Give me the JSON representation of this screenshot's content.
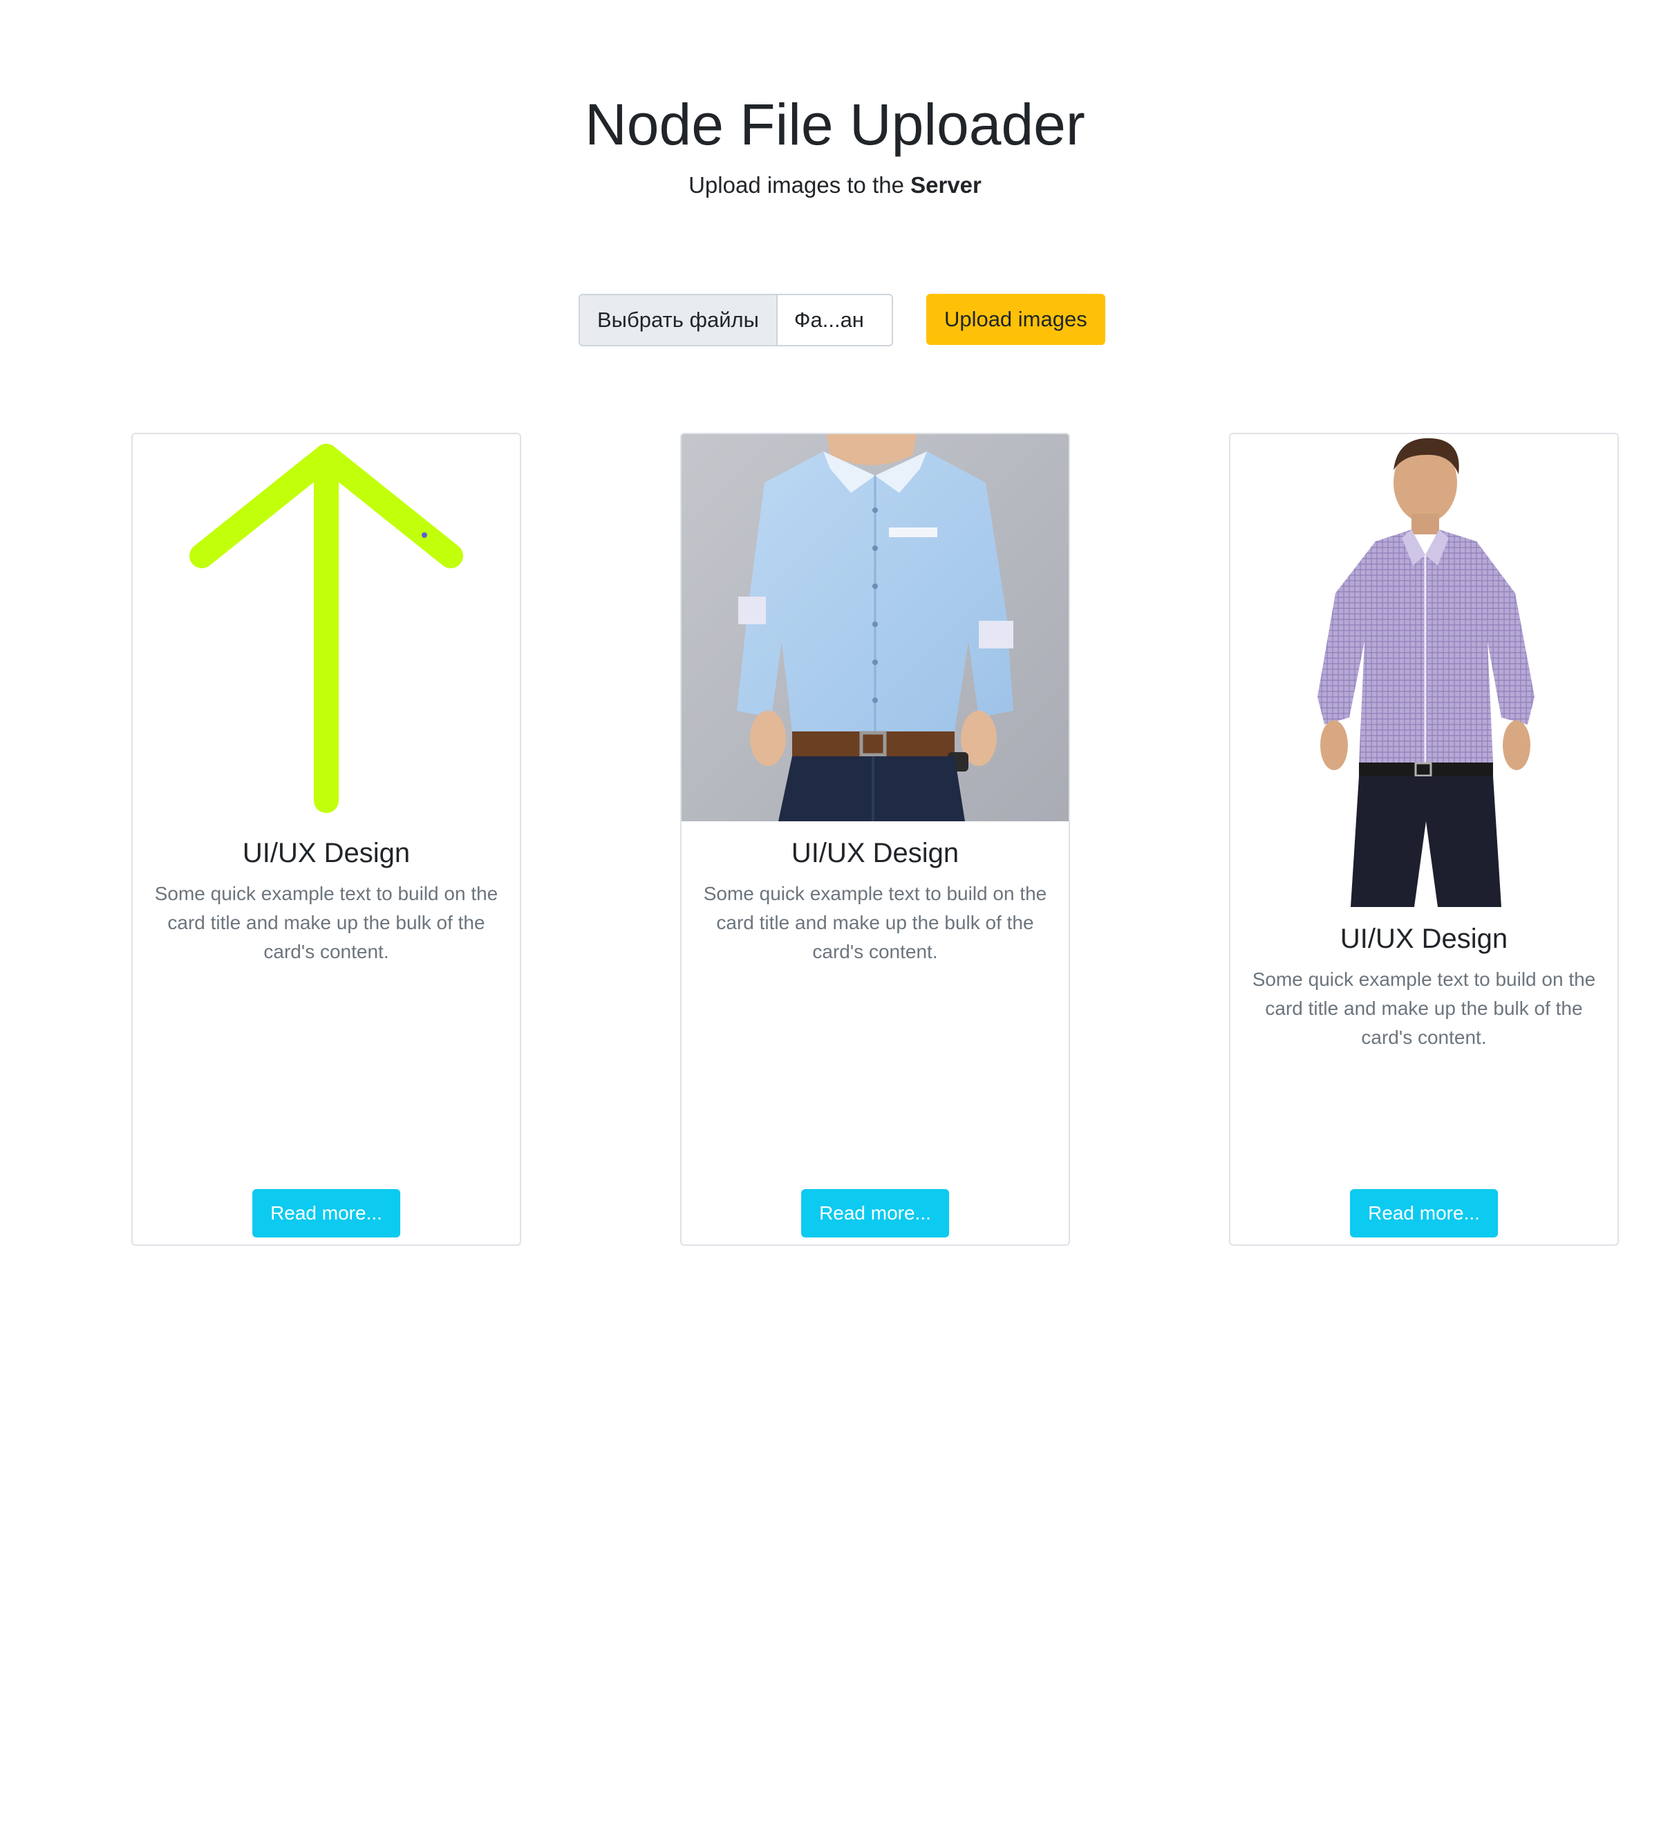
{
  "header": {
    "title": "Node File Uploader",
    "subtitle_prefix": "Upload images to the ",
    "subtitle_strong": "Server"
  },
  "upload": {
    "choose_label": "Выбрать файлы",
    "file_name": "Фа...ан",
    "upload_label": "Upload images"
  },
  "colors": {
    "upload_button": "#ffc107",
    "read_more_button": "#0dcaf0",
    "arrow": "#c2ff0a"
  },
  "cards": [
    {
      "image": "upload-arrow-icon",
      "title": "UI/UX Design",
      "text": "Some quick example text to build on the card title and make up the bulk of the card's content.",
      "button": "Read more..."
    },
    {
      "image": "blue-shirt-photo",
      "title": "UI/UX Design",
      "text": "Some quick example text to build on the card title and make up the bulk of the card's content.",
      "button": "Read more..."
    },
    {
      "image": "checked-shirt-photo",
      "title": "UI/UX Design",
      "text": "Some quick example text to build on the card title and make up the bulk of the card's content.",
      "button": "Read more..."
    }
  ]
}
